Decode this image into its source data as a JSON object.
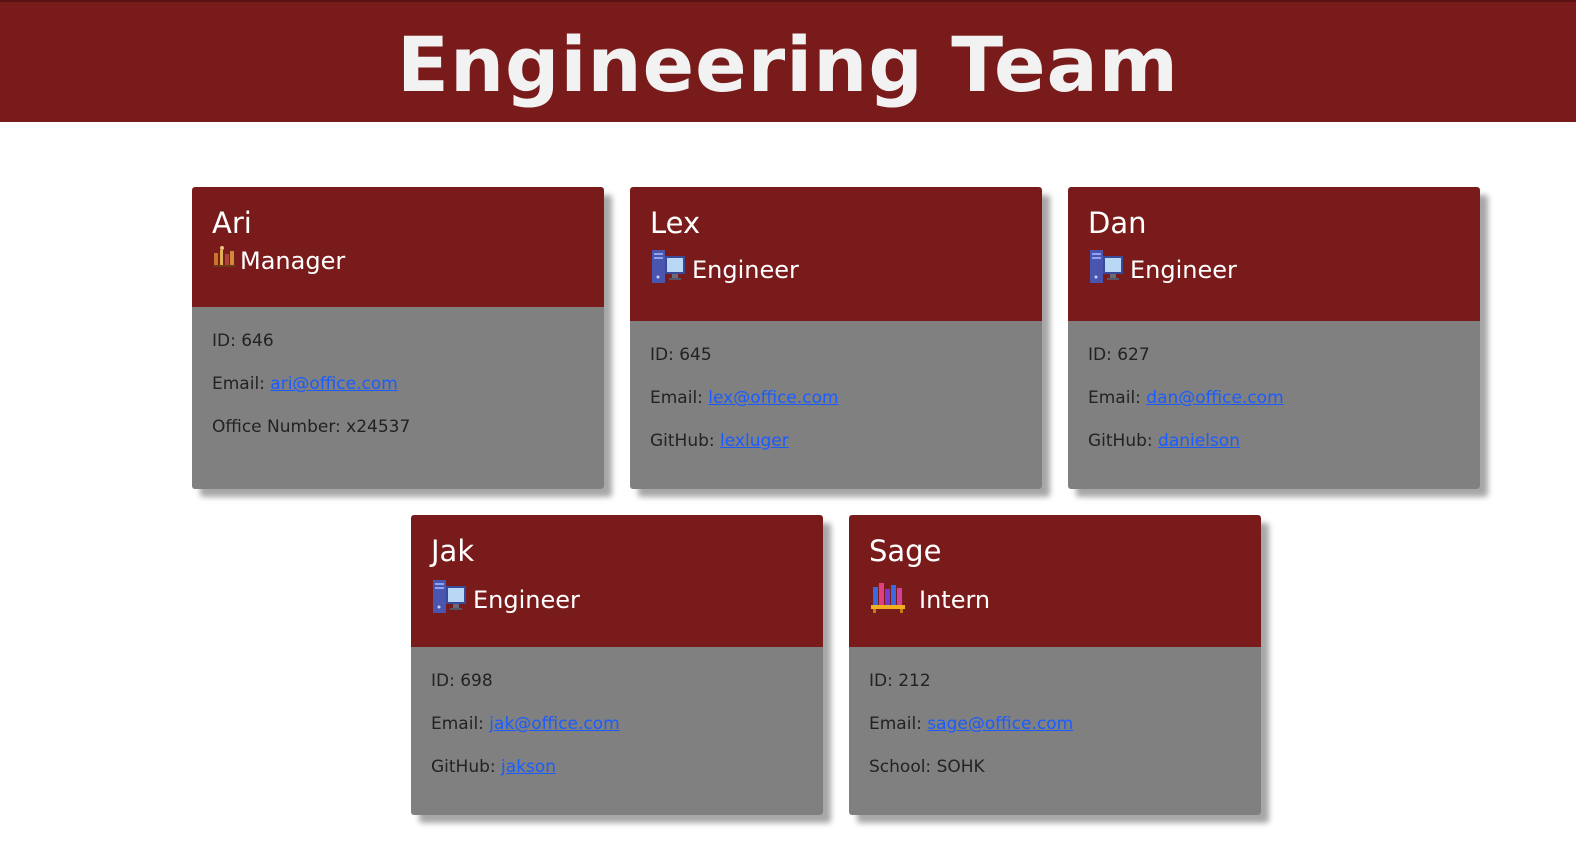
{
  "page": {
    "title": "Engineering Team"
  },
  "colors": {
    "header_bg": "#7a1b1b",
    "card_body_bg": "#808080",
    "link": "#1a5cff"
  },
  "cards": [
    {
      "name": "Ari",
      "role": "Manager",
      "role_icon": "manager-icon",
      "id_label": "ID: 646",
      "email_label": "Email: ",
      "email": "ari@office.com",
      "extra_label": "Office Number: x24537",
      "extra_link": ""
    },
    {
      "name": "Lex",
      "role": "Engineer",
      "role_icon": "computer-icon",
      "id_label": "ID: 645",
      "email_label": "Email: ",
      "email": "lex@office.com",
      "extra_label": "GitHub: ",
      "extra_link": "lexluger"
    },
    {
      "name": "Dan",
      "role": "Engineer",
      "role_icon": "computer-icon",
      "id_label": "ID: 627",
      "email_label": "Email: ",
      "email": "dan@office.com",
      "extra_label": "GitHub: ",
      "extra_link": "danielson"
    },
    {
      "name": "Jak",
      "role": "Engineer",
      "role_icon": "computer-icon",
      "id_label": "ID: 698",
      "email_label": "Email: ",
      "email": "jak@office.com",
      "extra_label": "GitHub: ",
      "extra_link": "jakson"
    },
    {
      "name": "Sage",
      "role": "Intern",
      "role_icon": "books-icon",
      "id_label": "ID: 212",
      "email_label": "Email: ",
      "email": "sage@office.com",
      "extra_label": "School: SOHK",
      "extra_link": ""
    }
  ]
}
